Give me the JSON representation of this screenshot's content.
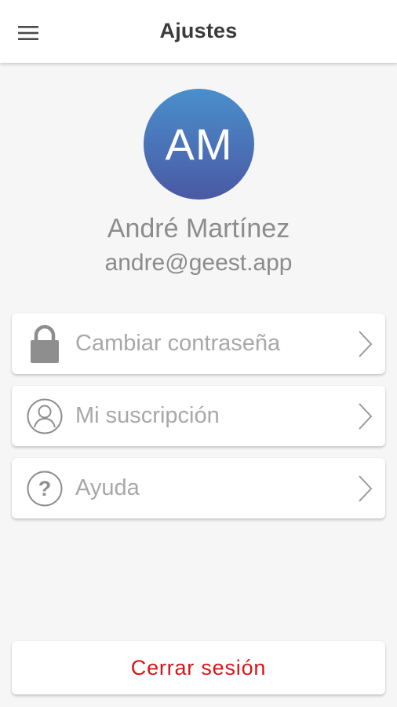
{
  "header": {
    "title": "Ajustes",
    "menu_icon": "hamburger-menu-icon"
  },
  "profile": {
    "initials": "AM",
    "name": "André Martínez",
    "email": "andre@geest.app",
    "avatar_colors": [
      "#4a8fcc",
      "#4a59a4"
    ]
  },
  "menu": {
    "items": [
      {
        "label": "Cambiar contraseña",
        "icon": "lock-icon"
      },
      {
        "label": "Mi suscripción",
        "icon": "user-circle-icon"
      },
      {
        "label": "Ayuda",
        "icon": "help-circle-icon"
      }
    ]
  },
  "logout": {
    "label": "Cerrar sesión",
    "color": "#d9141b"
  }
}
